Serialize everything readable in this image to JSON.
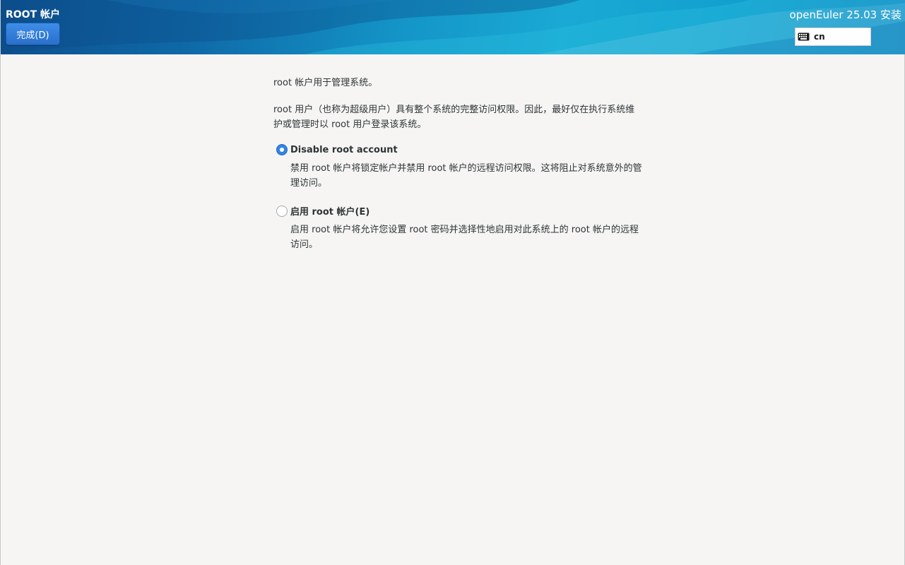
{
  "header": {
    "spoke_title": "ROOT 帐户",
    "done_button_label": "完成(D)",
    "product_title": "openEuler 25.03 安装",
    "keyboard_layout": "cn",
    "banner_color": "#1496c8",
    "keyboard_icon": "keyboard-icon"
  },
  "main": {
    "intro": "root 帐户用于管理系统。",
    "description": "root 用户（也称为超级用户）具有整个系统的完整访问权限。因此，最好仅在执行系统维护或管理时以 root 用户登录该系统。",
    "options": [
      {
        "label": "Disable root account",
        "selected": true,
        "description": "禁用 root 帐户将锁定帐户并禁用 root 帐户的远程访问权限。这将阻止对系统意外的管理访问。"
      },
      {
        "label": "启用 root 帐户(E)",
        "selected": false,
        "description": "启用 root 帐户将允许您设置 root 密码并选择性地启用对此系统上的 root 帐户的远程访问。"
      }
    ],
    "accent_color": "#3584e4"
  }
}
